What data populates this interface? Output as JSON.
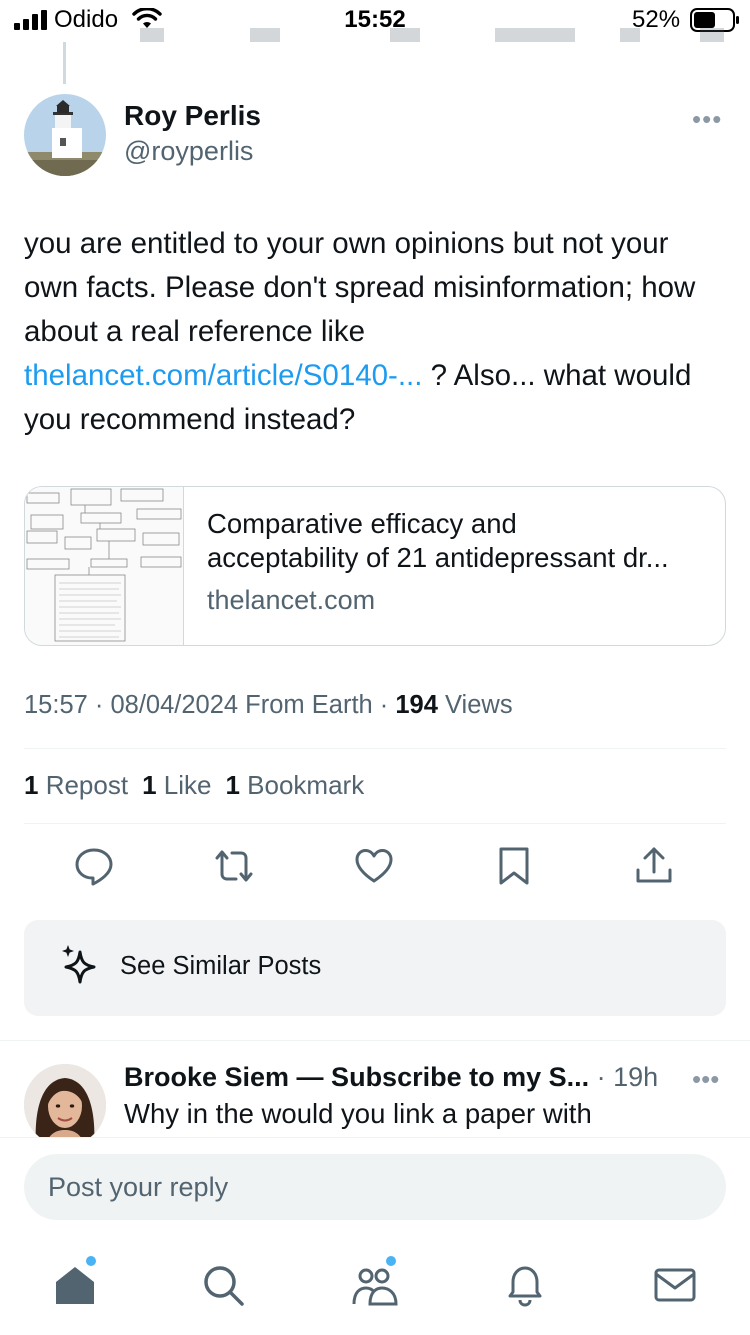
{
  "status_bar": {
    "carrier": "Odido",
    "time": "15:52",
    "battery": "52%"
  },
  "tweet": {
    "author_name": "Roy Perlis",
    "author_handle": "@royperlis",
    "text_before_link": "you are entitled to your own opinions but not your own facts. Please don't spread misinformation; how about a real reference like ",
    "link_text": "thelancet.com/article/S0140-...",
    "text_after_link": " ? Also... what would you recommend instead?",
    "card": {
      "title_line1": "Comparative efficacy and",
      "title_line2": "acceptability of 21 antidepressant dr...",
      "domain": "thelancet.com"
    },
    "meta": {
      "time_date": "15:57 · 08/04/2024 From Earth · ",
      "views_count": "194",
      "views_label": " Views"
    },
    "stats": {
      "reposts_count": "1",
      "reposts_label": " Repost",
      "likes_count": "1",
      "likes_label": " Like",
      "bookmarks_count": "1",
      "bookmarks_label": " Bookmark"
    }
  },
  "similar_posts_label": "See Similar Posts",
  "reply": {
    "author": "Brooke Siem — Subscribe to my S...",
    "time": " · 19h",
    "text": "Why in the would you link a paper with"
  },
  "reply_box": {
    "placeholder": "Post your reply"
  },
  "colors": {
    "link": "#1d9bf0",
    "secondary_text": "#536471",
    "notification_dot": "#4ab3f4"
  },
  "icons": {
    "actions": [
      "reply-icon",
      "repost-icon",
      "like-icon",
      "bookmark-icon",
      "share-icon"
    ],
    "tabs": [
      "home-icon",
      "search-icon",
      "communities-icon",
      "notifications-icon",
      "messages-icon"
    ]
  }
}
